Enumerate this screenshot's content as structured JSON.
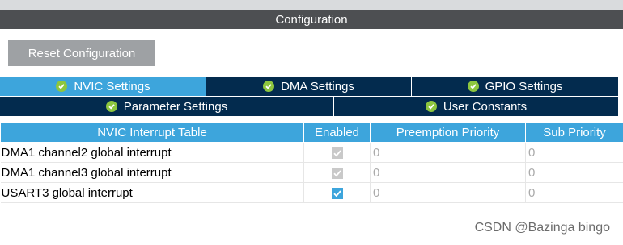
{
  "window": {
    "title": "Configuration"
  },
  "toolbar": {
    "reset_label": "Reset Configuration"
  },
  "tabs": {
    "row1": [
      {
        "label": "NVIC Settings",
        "active": true
      },
      {
        "label": "DMA Settings",
        "active": false
      },
      {
        "label": "GPIO Settings",
        "active": false
      }
    ],
    "row2": [
      {
        "label": "Parameter Settings",
        "active": false
      },
      {
        "label": "User Constants",
        "active": false
      }
    ]
  },
  "table": {
    "headers": [
      "NVIC Interrupt Table",
      "Enabled",
      "Preemption Priority",
      "Sub Priority"
    ],
    "rows": [
      {
        "name": "DMA1 channel2 global interrupt",
        "enabled": true,
        "editable": false,
        "preemption": "0",
        "sub": "0"
      },
      {
        "name": "DMA1 channel3 global interrupt",
        "enabled": true,
        "editable": false,
        "preemption": "0",
        "sub": "0"
      },
      {
        "name": "USART3 global interrupt",
        "enabled": true,
        "editable": true,
        "preemption": "0",
        "sub": "0"
      }
    ]
  },
  "watermark": "CSDN @Bazinga bingo",
  "colors": {
    "accent": "#3da5dc",
    "tab_dark": "#032b4e",
    "check_green": "#8dc63f",
    "title_bg": "#4d4f52"
  },
  "icons": {
    "tab_status": "check-circle-icon",
    "enabled": "checkbox-icon"
  }
}
